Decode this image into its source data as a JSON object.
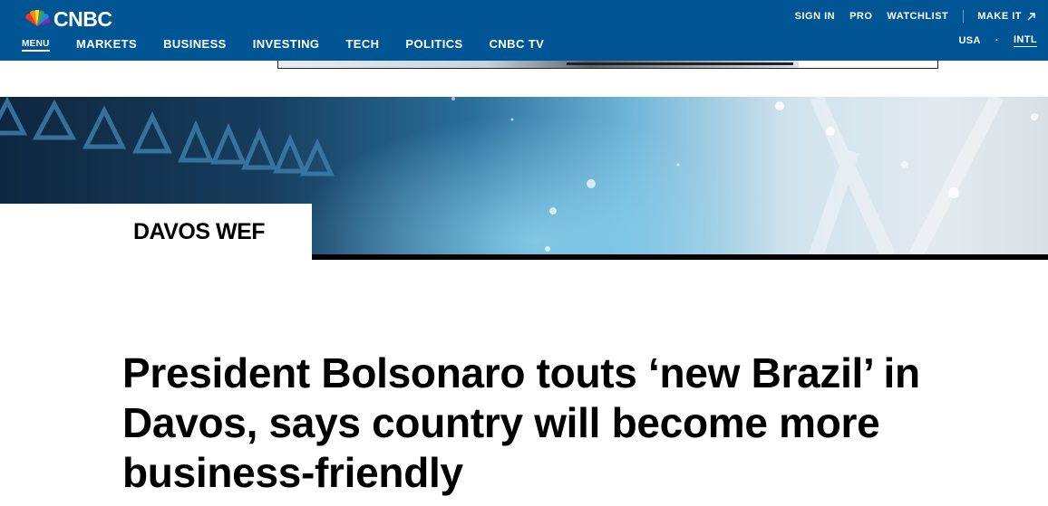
{
  "header": {
    "brand": "CNBC",
    "menu_label": "MENU",
    "nav": [
      "MARKETS",
      "BUSINESS",
      "INVESTING",
      "TECH",
      "POLITICS",
      "CNBC TV"
    ],
    "utility": {
      "sign_in": "SIGN IN",
      "pro": "PRO",
      "watchlist": "WATCHLIST",
      "make_it": "MAKE IT"
    },
    "region": {
      "usa": "USA",
      "separator": "·",
      "intl": "INTL",
      "active": "INTL"
    },
    "colors": {
      "bar": "#005594",
      "text": "#ffffff"
    }
  },
  "section": {
    "label": "DAVOS WEF"
  },
  "article": {
    "headline": "President Bolsonaro touts ‘new Brazil’ in Davos, says country will become more business-friendly"
  }
}
